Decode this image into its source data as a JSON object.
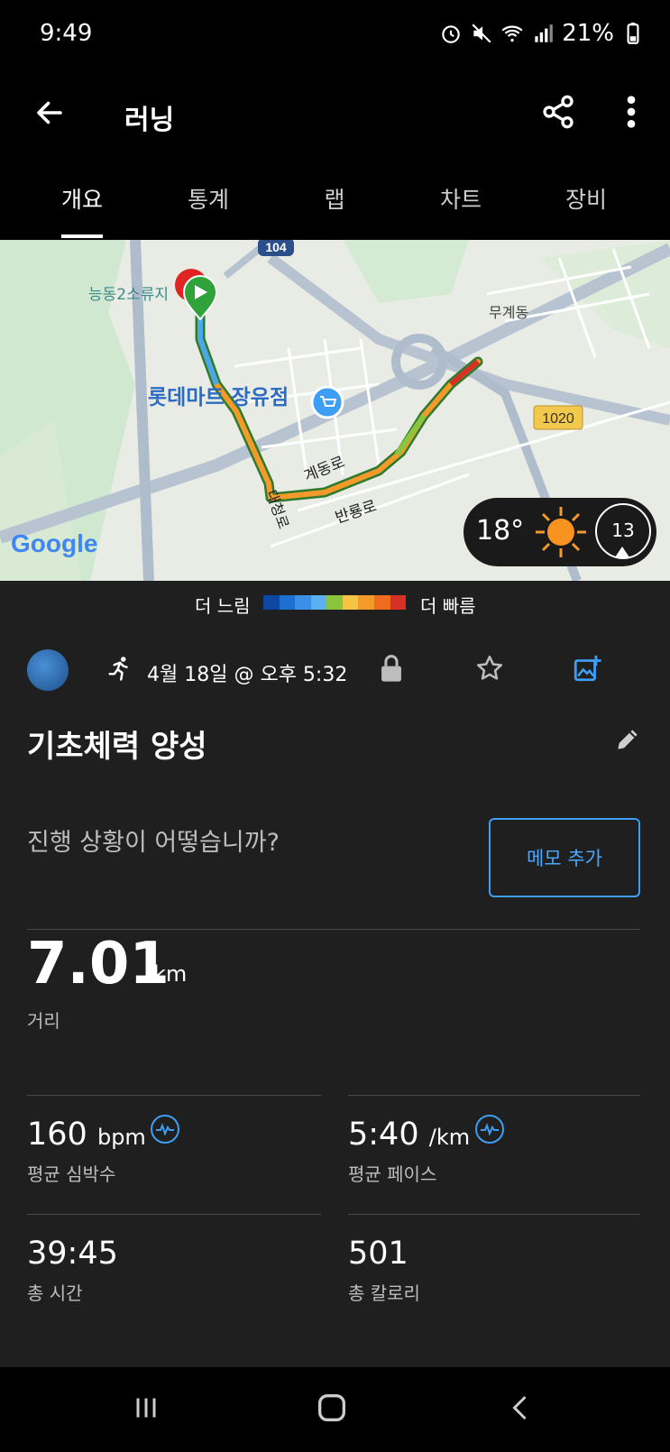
{
  "status_bar": {
    "time": "9:49",
    "battery": "21%"
  },
  "app_bar": {
    "title": "러닝"
  },
  "tabs": [
    {
      "label": "개요",
      "active": true
    },
    {
      "label": "통계",
      "active": false
    },
    {
      "label": "랩",
      "active": false
    },
    {
      "label": "차트",
      "active": false
    },
    {
      "label": "장비",
      "active": false
    }
  ],
  "map": {
    "labels": {
      "start_place": "능동2소류지",
      "store": "롯데마트 장유점",
      "district": "무계동",
      "road_104": "104",
      "road_1020": "1020",
      "road_gyedong": "계동로",
      "road_banryong": "반룡로",
      "road_daecheong": "대청로",
      "google": "Google"
    },
    "weather": {
      "temperature": "18°",
      "wind": "13",
      "icon": "sun-icon"
    }
  },
  "pace_legend": {
    "slow_label": "더 느림",
    "fast_label": "더 빠름",
    "colors": [
      "#0d47a1",
      "#1e6fd0",
      "#3b8fe6",
      "#5cb0ef",
      "#8bc53f",
      "#f4c542",
      "#f39a2b",
      "#ef6c1f",
      "#d93025"
    ]
  },
  "activity": {
    "date": "4월 18일 @ 오후 5:32",
    "name": "기초체력 양성",
    "prompt": "진행 상황이 어떻습니까?",
    "memo_button": "메모 추가"
  },
  "stats": {
    "distance": {
      "value": "7.01",
      "unit": "km",
      "label": "거리"
    },
    "avg_hr": {
      "value": "160",
      "unit": "bpm",
      "label": "평균 심박수"
    },
    "avg_pace": {
      "value": "5:40",
      "unit": "/km",
      "label": "평균 페이스"
    },
    "total_time": {
      "value": "39:45",
      "label": "총 시간"
    },
    "calories": {
      "value": "501",
      "label": "총 칼로리"
    }
  },
  "colors": {
    "accent": "#3d9ef5",
    "background": "#1f1f1f"
  }
}
